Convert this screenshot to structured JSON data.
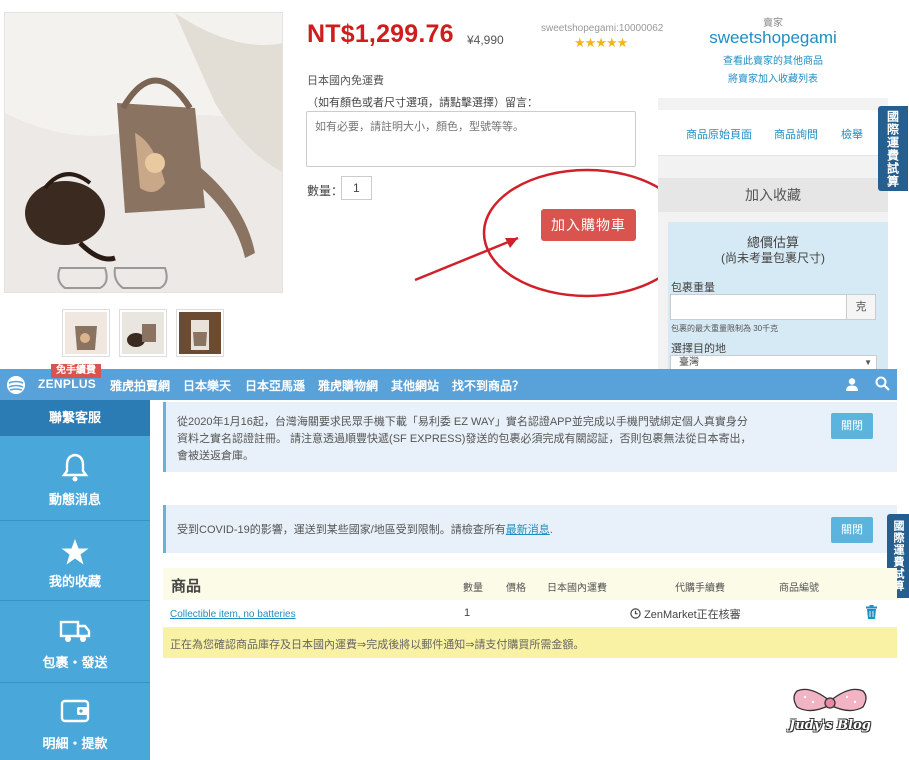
{
  "product": {
    "price_main": "NT$1,299.76",
    "price_yen": "¥4,990",
    "seller_id": "sweetshopegami:10000062",
    "stars": "★★★★★",
    "shipping_note": "日本國內免運費",
    "comment_label": "（如有顏色或者尺寸選項，請點擊選擇）留言：",
    "comment_placeholder": "如有必要，請註明大小，顏色，型號等等。",
    "qty_label": "數量：",
    "qty_value": "1",
    "add_cart_label": "加入購物車"
  },
  "seller": {
    "role": "賣家",
    "name": "sweetshopegami",
    "link_other_items": "查看此賣家的其他商品",
    "link_add_fav": "將賣家加入收藏列表"
  },
  "product_tabs": [
    "商品原始頁面",
    "商品詢問",
    "檢舉"
  ],
  "add_favorite_label": "加入收藏",
  "estimate": {
    "title": "總價估算",
    "subtitle": "(尚未考量包裹尺寸)",
    "weight_label": "包裹重量",
    "weight_unit": "克",
    "weight_limit": "包裹的最大重量限制為 30千克",
    "dest_label": "選擇目的地",
    "dest_value": "臺灣"
  },
  "side_tab_label": "國際運費試算",
  "nav": {
    "logo_text": "ZENPLUS",
    "logo_badge": "免手續費",
    "links": [
      "雅虎拍賣網",
      "日本樂天",
      "日本亞馬遜",
      "雅虎購物網",
      "其他網站",
      "找不到商品？"
    ]
  },
  "sidebar": {
    "header": "聯繫客服",
    "items": [
      {
        "label": "動態消息",
        "icon": "bell-icon"
      },
      {
        "label": "我的收藏",
        "icon": "star-icon"
      },
      {
        "label": "包裹・發送",
        "icon": "truck-icon"
      },
      {
        "label": "明細・提款",
        "icon": "wallet-icon"
      }
    ]
  },
  "notices": {
    "notice1": "從2020年1月16起，台灣海關要求民眾手機下載「易利委 EZ WAY」實名認證APP並完成以手機門號綁定個人真實身分資料之實名認證註冊。 請注意透過順豐快遞(SF EXPRESS)發送的包裹必須完成有關認証，否則包裹無法從日本寄出，會被送返倉庫。",
    "notice2_prefix": "受到COVID-19的影響，運送到某些國家/地區受到限制。請檢查所有",
    "notice2_link": "最新消息",
    "notice2_suffix": ".",
    "close_label": "關閉"
  },
  "cart_table": {
    "title": "商品",
    "columns": [
      "數量",
      "價格",
      "日本國內運費",
      "代購手續費",
      "商品編號"
    ],
    "rows": [
      {
        "item": "Collectible item, no batteries",
        "qty": "1",
        "status": "ZenMarket正在核審"
      }
    ],
    "note": "正在為您確認商品庫存及日本國內運費⇒完成後將以郵件通知⇒請支付購買所需金額。"
  },
  "watermark": "Judy's Blog",
  "colors": {
    "price_red": "#cf1d1d",
    "link_blue": "#1f8ec2",
    "nav_blue": "#58a1d9",
    "sidebar_blue": "#4aa7d9",
    "sidebar_header": "#2b7bb5",
    "cart_button": "#d9534f",
    "annotation_red": "#d0202a",
    "note_yellow": "#f9f1a3"
  }
}
